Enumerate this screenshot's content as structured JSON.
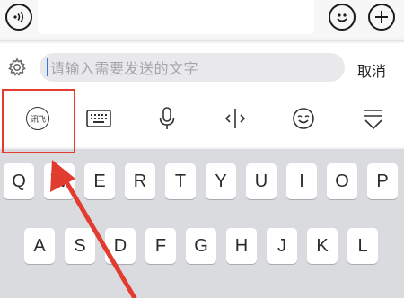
{
  "top_bar": {
    "voice_icon": "volume-wave-icon",
    "emoji_icon": "smiley-icon",
    "add_icon": "plus-icon"
  },
  "search": {
    "settings_icon": "gear-icon",
    "placeholder": "请输入需要发送的文字",
    "cancel_label": "取消"
  },
  "toolbar": {
    "items": [
      "handwriting-icon",
      "keyboard-icon",
      "microphone-icon",
      "cursor-move-icon",
      "emoji-icon",
      "hide-keyboard-icon"
    ],
    "handwriting_glyph": "讯飞"
  },
  "keyboard": {
    "row1": [
      "Q",
      "W",
      "E",
      "R",
      "T",
      "Y",
      "U",
      "I",
      "O",
      "P"
    ],
    "row2": [
      "A",
      "S",
      "D",
      "F",
      "G",
      "H",
      "J",
      "K",
      "L"
    ]
  },
  "annotation": {
    "color": "#e23b2f"
  }
}
